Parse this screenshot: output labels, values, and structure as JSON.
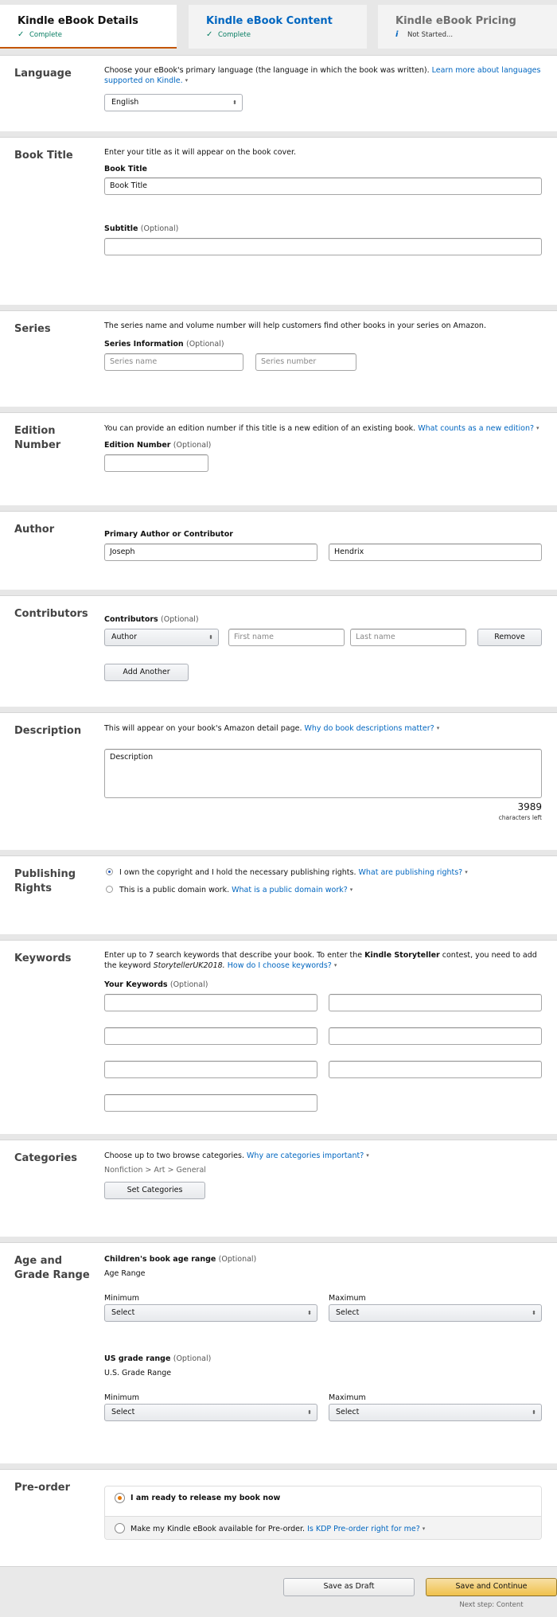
{
  "tabs": [
    {
      "title": "Kindle eBook Details",
      "status": "Complete",
      "status_icon": "check-icon",
      "active": true
    },
    {
      "title": "Kindle eBook Content",
      "status": "Complete",
      "status_icon": "check-icon",
      "active": false
    },
    {
      "title": "Kindle eBook Pricing",
      "status": "Not Started...",
      "status_icon": "info-icon",
      "active": false
    }
  ],
  "icons": {
    "check": "✓",
    "info": "i",
    "caret": "▾",
    "select_arrows": "⬍"
  },
  "language": {
    "label": "Language",
    "description": "Choose your eBook's primary language (the language in which the book was written).",
    "link": "Learn more about languages supported on Kindle.",
    "selected": "English"
  },
  "book_title": {
    "label": "Book Title",
    "description": "Enter your title as it will appear on the book cover.",
    "title_label": "Book Title",
    "title_value": "Book Title",
    "subtitle_label": "Subtitle",
    "subtitle_value": ""
  },
  "optional": "(Optional)",
  "series": {
    "label": "Series",
    "description": "The series name and volume number will help customers find other books in your series on Amazon.",
    "field_label": "Series Information",
    "name_placeholder": "Series name",
    "number_placeholder": "Series number"
  },
  "edition": {
    "label": "Edition Number",
    "description": "You can provide an edition number if this title is a new edition of an existing book.",
    "link": "What counts as a new edition?",
    "field_label": "Edition Number",
    "value": ""
  },
  "author": {
    "label": "Author",
    "field_label": "Primary Author or Contributor",
    "first_name": "Joseph",
    "last_name": "Hendrix"
  },
  "contributors": {
    "label": "Contributors",
    "field_label": "Contributors",
    "role": "Author",
    "first_placeholder": "First name",
    "last_placeholder": "Last name",
    "remove_label": "Remove",
    "add_label": "Add Another"
  },
  "description": {
    "label": "Description",
    "text": "This will appear on your book's Amazon detail page.",
    "link": "Why do book descriptions matter?",
    "value": "Description",
    "chars_left": "3989",
    "chars_left_label": "characters left"
  },
  "rights": {
    "label": "Publishing Rights",
    "options": [
      {
        "text": "I own the copyright and I hold the necessary publishing rights.",
        "link": "What are publishing rights?",
        "selected": true
      },
      {
        "text": "This is a public domain work.",
        "link": "What is a public domain work?",
        "selected": false
      }
    ]
  },
  "keywords": {
    "label": "Keywords",
    "text_1": "Enter up to 7 search keywords that describe your book. To enter the",
    "bold": "Kindle Storyteller",
    "text_2": "contest, you need to add the keyword",
    "italic": "StorytellerUK2018.",
    "link": "How do I choose keywords?",
    "field_label": "Your Keywords",
    "values": [
      "",
      "",
      "",
      "",
      "",
      "",
      ""
    ]
  },
  "categories": {
    "label": "Categories",
    "text": "Choose up to two browse categories.",
    "link": "Why are categories important?",
    "selected": "Nonfiction > Art > General",
    "button": "Set Categories"
  },
  "age_grade": {
    "label": "Age and Grade Range",
    "age_label": "Children's book age range",
    "age_sub": "Age Range",
    "grade_label": "US grade range",
    "grade_sub": "U.S. Grade Range",
    "min_label": "Minimum",
    "max_label": "Maximum",
    "age_min": "Select",
    "age_max": "Select",
    "grade_min": "Select",
    "grade_max": "Select"
  },
  "preorder": {
    "label": "Pre-order",
    "option_now": "I am ready to release my book now",
    "option_preorder": "Make my Kindle eBook available for Pre-order.",
    "link": "Is KDP Pre-order right for me?",
    "selected": "now"
  },
  "footer": {
    "draft": "Save as Draft",
    "continue": "Save and Continue",
    "next_step": "Next step: Content"
  },
  "colors": {
    "link": "#0066c0",
    "active_tab_underline": "#c45500",
    "complete_green": "#067d62",
    "primary_button": "#f0c14b",
    "preorder_radio": "#e77600"
  }
}
